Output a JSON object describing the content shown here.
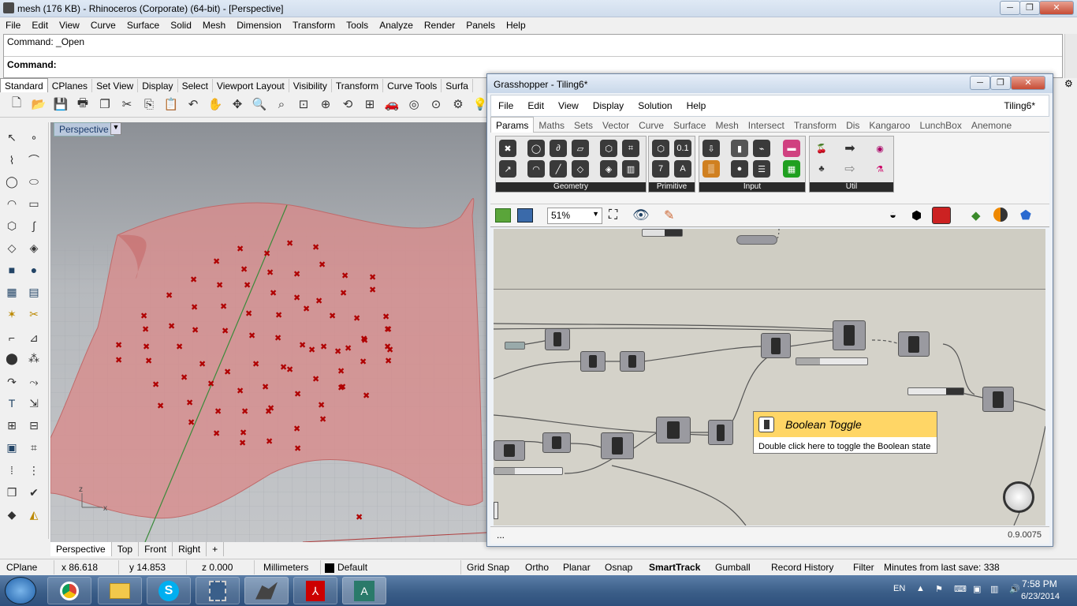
{
  "rhino": {
    "title": "mesh (176 KB) - Rhinoceros (Corporate) (64-bit) - [Perspective]",
    "menu": [
      "File",
      "Edit",
      "View",
      "Curve",
      "Surface",
      "Solid",
      "Mesh",
      "Dimension",
      "Transform",
      "Tools",
      "Analyze",
      "Render",
      "Panels",
      "Help"
    ],
    "command_history": "Command: _Open",
    "command_prompt": "Command:",
    "toolbar_tabs": [
      "Standard",
      "CPlanes",
      "Set View",
      "Display",
      "Select",
      "Viewport Layout",
      "Visibility",
      "Transform",
      "Curve Tools",
      "Surfa"
    ],
    "viewport_label": "Perspective",
    "viewport_tabs": [
      "Perspective",
      "Top",
      "Front",
      "Right",
      "+"
    ],
    "axis_labels": {
      "z": "z",
      "x": "x"
    }
  },
  "status": {
    "cplane": "CPlane",
    "x": "x 86.618",
    "y": "y 14.853",
    "z": "z 0.000",
    "units": "Millimeters",
    "layer": "Default",
    "toggles": [
      "Grid Snap",
      "Ortho",
      "Planar",
      "Osnap",
      "SmartTrack",
      "Gumball",
      "Record History",
      "Filter"
    ],
    "save_info": "Minutes from last save: 338"
  },
  "taskbar": {
    "lang": "EN",
    "time": "7:58 PM",
    "date": "6/23/2014"
  },
  "grasshopper": {
    "title": "Grasshopper - Tiling6*",
    "menu": [
      "File",
      "Edit",
      "View",
      "Display",
      "Solution",
      "Help"
    ],
    "doc_name": "Tiling6*",
    "tabs": [
      "Params",
      "Maths",
      "Sets",
      "Vector",
      "Curve",
      "Surface",
      "Mesh",
      "Intersect",
      "Transform",
      "Dis",
      "Kangaroo",
      "LunchBox",
      "Anemone"
    ],
    "groups": [
      "Geometry",
      "Primitive",
      "Input",
      "Util"
    ],
    "zoom": "51%",
    "tooltip_title": "Boolean Toggle",
    "tooltip_body": "Double click here to toggle the Boolean state",
    "version": "0.9.0075",
    "footer_left": "..."
  },
  "colors": {
    "surface": "#d98a8a",
    "points": "#b00000",
    "tooltip_header": "#ffd666",
    "canvas": "#d4d2c9"
  }
}
